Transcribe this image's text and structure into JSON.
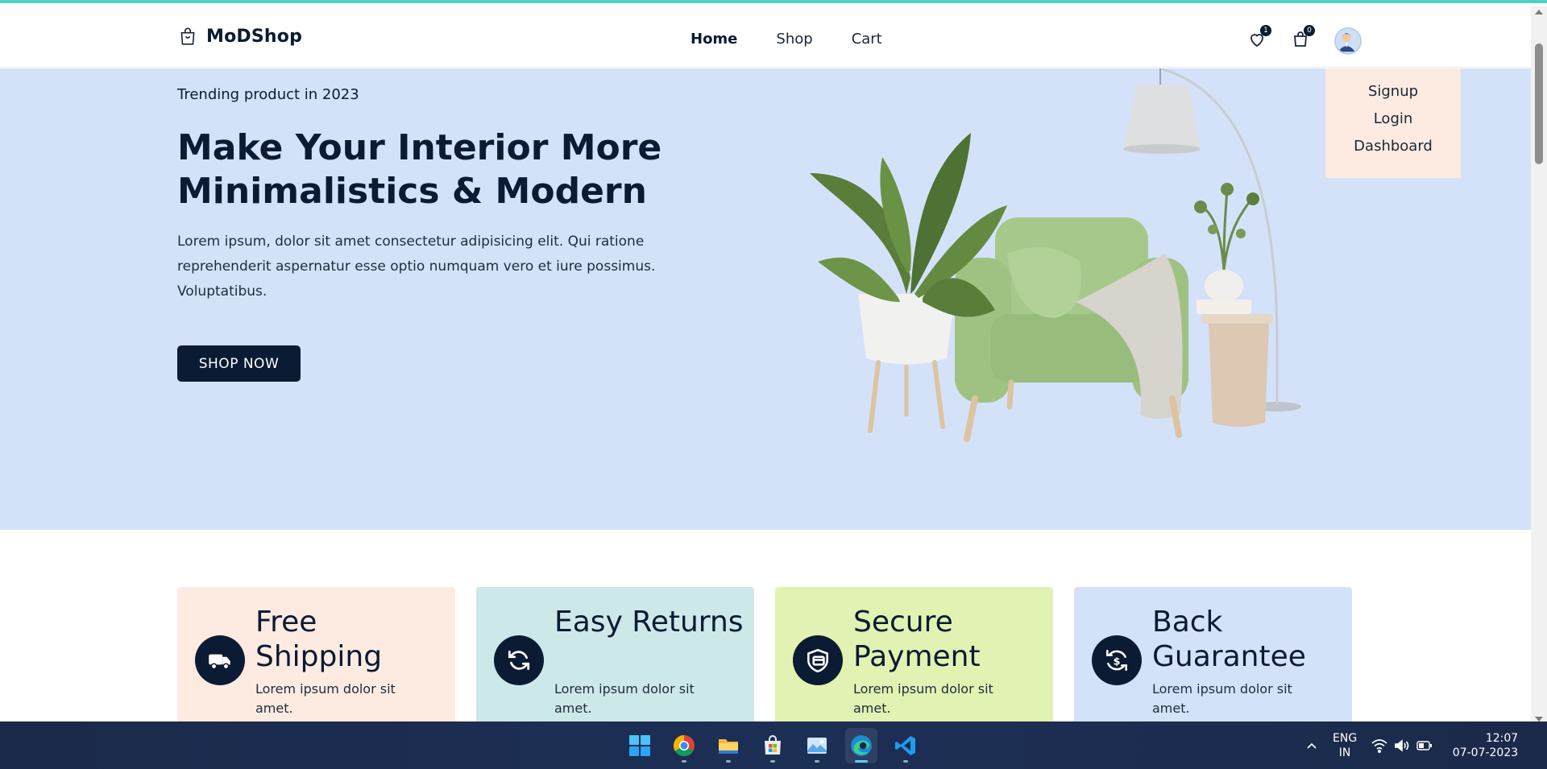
{
  "brand": {
    "name": "MoDShop",
    "icon": "shopping-bag-icon"
  },
  "nav": {
    "items": [
      {
        "label": "Home",
        "active": true
      },
      {
        "label": "Shop",
        "active": false
      },
      {
        "label": "Cart",
        "active": false
      }
    ]
  },
  "header_icons": {
    "wishlist_count": "1",
    "cart_count": "0"
  },
  "user_menu": {
    "items": [
      "Signup",
      "Login",
      "Dashboard"
    ]
  },
  "hero": {
    "tag": "Trending product in 2023",
    "headline": "Make Your Interior More Minimalistics & Modern",
    "description": "Lorem ipsum, dolor sit amet consectetur adipisicing elit. Qui ratione reprehenderit aspernatur esse optio numquam vero et iure possimus. Voluptatibus.",
    "cta": "SHOP NOW"
  },
  "features": [
    {
      "title": "Free Shipping",
      "text": "Lorem ipsum dolor sit amet.",
      "icon": "truck-icon",
      "bg": "#fdebe1"
    },
    {
      "title": "Easy Returns",
      "text": "Lorem ipsum dolor sit amet.",
      "icon": "refresh-icon",
      "bg": "#cde8e8"
    },
    {
      "title": "Secure Payment",
      "text": "Lorem ipsum dolor sit amet.",
      "icon": "secure-card-icon",
      "bg": "#e1f2b2"
    },
    {
      "title": "Back Guarantee",
      "text": "Lorem ipsum dolor sit amet.",
      "icon": "money-back-icon",
      "bg": "#d4e2f9"
    }
  ],
  "taskbar": {
    "apps": [
      "windows-start-icon",
      "chrome-icon",
      "file-explorer-icon",
      "microsoft-store-icon",
      "photos-icon",
      "edge-icon",
      "vscode-icon"
    ],
    "active_app": "edge-icon",
    "lang_line1": "ENG",
    "lang_line2": "IN",
    "time": "12:07",
    "date": "07-07-2023"
  },
  "colors": {
    "primary": "#0b1b33",
    "hero_bg": "#d4e2f9",
    "accent_top": "#4fd1c5",
    "dropdown_bg": "#fdebe1"
  }
}
